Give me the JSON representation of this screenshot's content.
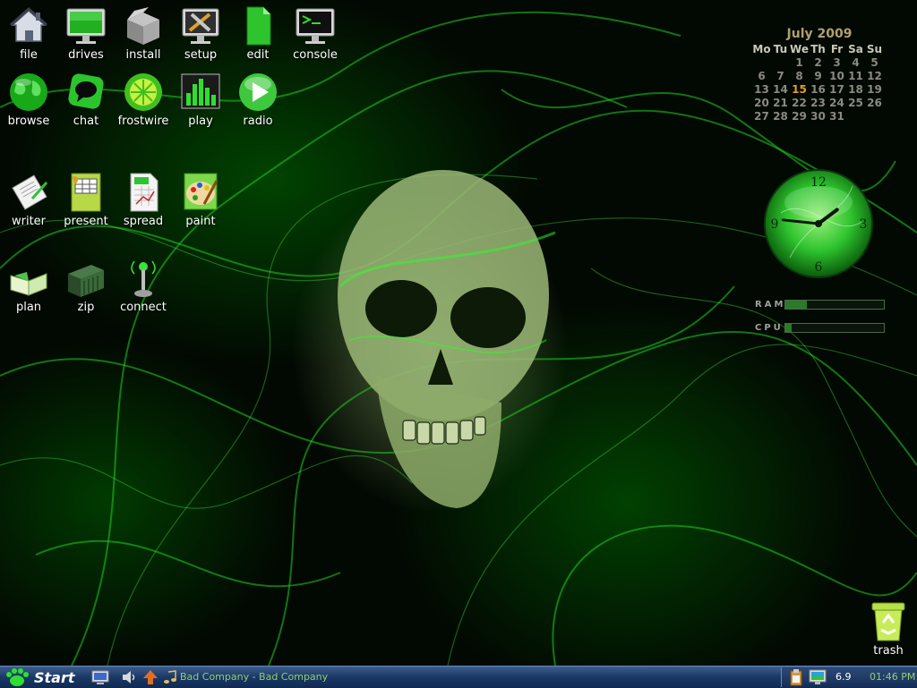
{
  "desktop": {
    "icons": [
      {
        "label": "file",
        "icon": "home-folder-icon"
      },
      {
        "label": "drives",
        "icon": "monitor-icon"
      },
      {
        "label": "install",
        "icon": "package-box-icon"
      },
      {
        "label": "setup",
        "icon": "tools-settings-icon"
      },
      {
        "label": "edit",
        "icon": "text-document-icon"
      },
      {
        "label": "console",
        "icon": "terminal-icon"
      },
      {
        "label": "browse",
        "icon": "globe-icon"
      },
      {
        "label": "chat",
        "icon": "chat-bubble-icon"
      },
      {
        "label": "frostwire",
        "icon": "frostwire-icon"
      },
      {
        "label": "play",
        "icon": "equalizer-icon"
      },
      {
        "label": "radio",
        "icon": "play-circle-icon"
      },
      {
        "label": "writer",
        "icon": "writer-document-icon"
      },
      {
        "label": "present",
        "icon": "presentation-icon"
      },
      {
        "label": "spread",
        "icon": "spreadsheet-icon"
      },
      {
        "label": "paint",
        "icon": "paint-palette-icon"
      },
      {
        "label": "plan",
        "icon": "open-book-icon"
      },
      {
        "label": "zip",
        "icon": "archive-container-icon"
      },
      {
        "label": "connect",
        "icon": "antenna-icon"
      },
      {
        "label": "trash",
        "icon": "trash-recycle-icon"
      }
    ]
  },
  "calendar": {
    "title": "July 2009",
    "weekdays": [
      "Mo",
      "Tu",
      "We",
      "Th",
      "Fr",
      "Sa",
      "Su"
    ],
    "weeks": [
      [
        "",
        "",
        "1",
        "2",
        "3",
        "4",
        "5"
      ],
      [
        "6",
        "7",
        "8",
        "9",
        "10",
        "11",
        "12"
      ],
      [
        "13",
        "14",
        "15",
        "16",
        "17",
        "18",
        "19"
      ],
      [
        "20",
        "21",
        "22",
        "23",
        "24",
        "25",
        "26"
      ],
      [
        "27",
        "28",
        "29",
        "30",
        "31",
        "",
        ""
      ]
    ],
    "today": "15",
    "today_color": "#e0a020"
  },
  "clock": {
    "numerals": [
      "12",
      "3",
      "6",
      "9"
    ],
    "hour": 1,
    "minute": 46
  },
  "monitors": {
    "ram": {
      "label": "RAM",
      "fraction": 0.22
    },
    "cpu": {
      "label": "CPU",
      "fraction": 0.06
    }
  },
  "taskbar": {
    "start_label": "Start",
    "task_title": "Bad Company - Bad Company",
    "tray_value": "6.9",
    "time": "01:46 PM"
  },
  "colors": {
    "accent_green": "#8fd06a",
    "taskbar_blue": "#1a3866"
  }
}
